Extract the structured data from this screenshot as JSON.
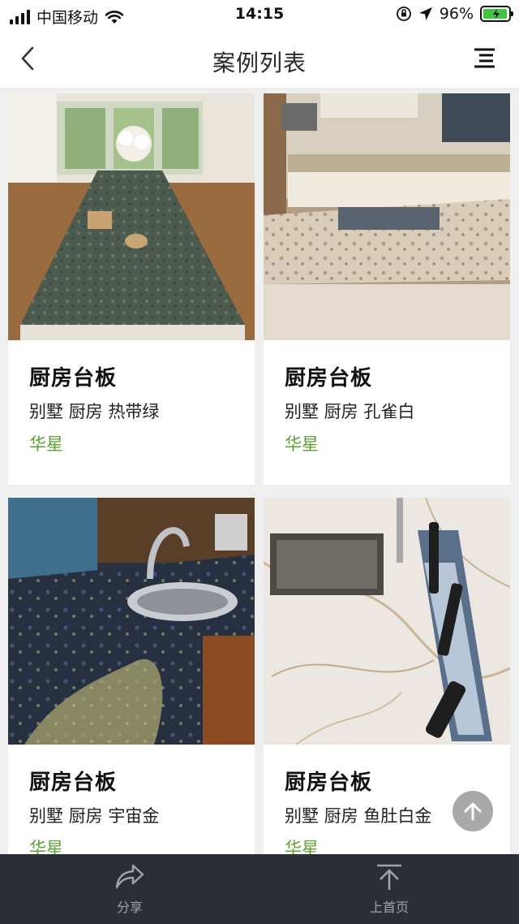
{
  "status_bar": {
    "carrier": "中国移动",
    "time": "14:15",
    "battery": "96%",
    "battery_level": 0.96
  },
  "nav": {
    "title": "案例列表"
  },
  "cases": [
    {
      "title": "厨房台板",
      "tags": "别墅 厨房 热带绿",
      "brand": "华星"
    },
    {
      "title": "厨房台板",
      "tags": "别墅 厨房 孔雀白",
      "brand": "华星"
    },
    {
      "title": "厨房台板",
      "tags": "别墅 厨房 宇宙金",
      "brand": "华星"
    },
    {
      "title": "厨房台板",
      "tags": "别墅 厨房 鱼肚白金",
      "brand": "华星"
    }
  ],
  "bottom_bar": {
    "share_label": "分享",
    "home_label": "上首页"
  },
  "colors": {
    "brand_green": "#5fa034",
    "bottom_bar": "#2b2f35",
    "battery_green": "#3ec43e"
  }
}
